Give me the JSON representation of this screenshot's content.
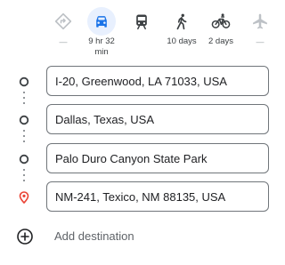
{
  "travel_modes": [
    {
      "id": "best",
      "icon": "best-route-diamond-icon",
      "label": "—",
      "available": false,
      "selected": false
    },
    {
      "id": "driving",
      "icon": "car-icon",
      "label": "9 hr 32\nmin",
      "available": true,
      "selected": true
    },
    {
      "id": "transit",
      "icon": "train-icon",
      "label": "",
      "available": true,
      "selected": false
    },
    {
      "id": "walking",
      "icon": "walking-person-icon",
      "label": "10 days",
      "available": true,
      "selected": false
    },
    {
      "id": "cycling",
      "icon": "bicycle-icon",
      "label": "2 days",
      "available": true,
      "selected": false
    },
    {
      "id": "flights",
      "icon": "airplane-icon",
      "label": "—",
      "available": false,
      "selected": false
    }
  ],
  "waypoints": [
    {
      "value": "I-20, Greenwood, LA 71033, USA",
      "marker": "origin-circle-icon"
    },
    {
      "value": "Dallas, Texas, USA",
      "marker": "waypoint-circle-icon"
    },
    {
      "value": "Palo Duro Canyon State Park",
      "marker": "waypoint-circle-icon"
    },
    {
      "value": "NM-241, Texico, NM 88135, USA",
      "marker": "destination-pin-icon"
    }
  ],
  "add_destination": {
    "label": "Add destination",
    "icon": "add-circle-icon"
  },
  "colors": {
    "accent": "#1a73e8",
    "selected_bg": "#e8f0fe",
    "destination_pin": "#ea4335",
    "disabled": "#bdc1c6"
  }
}
